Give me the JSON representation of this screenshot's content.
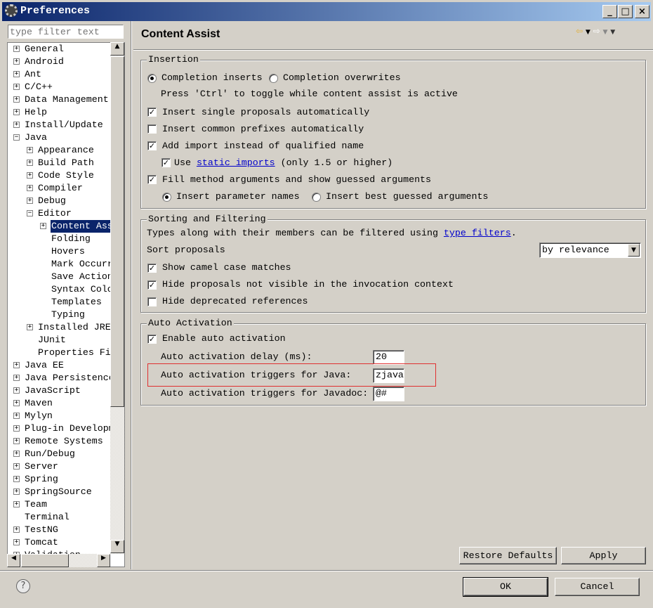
{
  "window": {
    "title": "Preferences",
    "minimize": "_",
    "maximize": "□",
    "close": "×"
  },
  "filter": {
    "placeholder": "type filter text"
  },
  "tree": [
    {
      "label": "General",
      "level": 0,
      "exp": "+"
    },
    {
      "label": "Android",
      "level": 0,
      "exp": "+"
    },
    {
      "label": "Ant",
      "level": 0,
      "exp": "+"
    },
    {
      "label": "C/C++",
      "level": 0,
      "exp": "+"
    },
    {
      "label": "Data Management",
      "level": 0,
      "exp": "+"
    },
    {
      "label": "Help",
      "level": 0,
      "exp": "+"
    },
    {
      "label": "Install/Update",
      "level": 0,
      "exp": "+"
    },
    {
      "label": "Java",
      "level": 0,
      "exp": "-"
    },
    {
      "label": "Appearance",
      "level": 1,
      "exp": "+"
    },
    {
      "label": "Build Path",
      "level": 1,
      "exp": "+"
    },
    {
      "label": "Code Style",
      "level": 1,
      "exp": "+"
    },
    {
      "label": "Compiler",
      "level": 1,
      "exp": "+"
    },
    {
      "label": "Debug",
      "level": 1,
      "exp": "+"
    },
    {
      "label": "Editor",
      "level": 1,
      "exp": "-"
    },
    {
      "label": "Content Assist",
      "level": 2,
      "exp": "+",
      "selected": true
    },
    {
      "label": "Folding",
      "level": 2,
      "exp": ""
    },
    {
      "label": "Hovers",
      "level": 2,
      "exp": ""
    },
    {
      "label": "Mark Occurrences",
      "level": 2,
      "exp": ""
    },
    {
      "label": "Save Actions",
      "level": 2,
      "exp": ""
    },
    {
      "label": "Syntax Coloring",
      "level": 2,
      "exp": ""
    },
    {
      "label": "Templates",
      "level": 2,
      "exp": ""
    },
    {
      "label": "Typing",
      "level": 2,
      "exp": ""
    },
    {
      "label": "Installed JREs",
      "level": 1,
      "exp": "+"
    },
    {
      "label": "JUnit",
      "level": 1,
      "exp": ""
    },
    {
      "label": "Properties Files Editor",
      "level": 1,
      "exp": ""
    },
    {
      "label": "Java EE",
      "level": 0,
      "exp": "+"
    },
    {
      "label": "Java Persistence",
      "level": 0,
      "exp": "+"
    },
    {
      "label": "JavaScript",
      "level": 0,
      "exp": "+"
    },
    {
      "label": "Maven",
      "level": 0,
      "exp": "+"
    },
    {
      "label": "Mylyn",
      "level": 0,
      "exp": "+"
    },
    {
      "label": "Plug-in Development",
      "level": 0,
      "exp": "+"
    },
    {
      "label": "Remote Systems",
      "level": 0,
      "exp": "+"
    },
    {
      "label": "Run/Debug",
      "level": 0,
      "exp": "+"
    },
    {
      "label": "Server",
      "level": 0,
      "exp": "+"
    },
    {
      "label": "Spring",
      "level": 0,
      "exp": "+"
    },
    {
      "label": "SpringSource",
      "level": 0,
      "exp": "+"
    },
    {
      "label": "Team",
      "level": 0,
      "exp": "+"
    },
    {
      "label": "Terminal",
      "level": 0,
      "exp": ""
    },
    {
      "label": "TestNG",
      "level": 0,
      "exp": "+"
    },
    {
      "label": "Tomcat",
      "level": 0,
      "exp": "+"
    },
    {
      "label": "Validation",
      "level": 0,
      "exp": "+"
    }
  ],
  "page": {
    "title": "Content Assist",
    "nav_icons": [
      "back-arrow-icon",
      "dropdown-icon",
      "forward-arrow-icon",
      "dropdown-icon",
      "menu-dropdown-icon"
    ]
  },
  "insertion": {
    "legend": "Insertion",
    "completion_inserts": "Completion inserts",
    "completion_overwrites": "Completion overwrites",
    "hint": "Press 'Ctrl' to toggle while content assist is active",
    "single_proposals": "Insert single proposals automatically",
    "common_prefixes": "Insert common prefixes automatically",
    "add_import": "Add import instead of qualified name",
    "use": "Use",
    "static_imports": "static imports",
    "only": "(only 1.5 or higher)",
    "fill_args": "Fill method arguments and show guessed arguments",
    "param_names": "Insert parameter names",
    "best_guessed": "Insert best guessed arguments",
    "checked": {
      "single": true,
      "prefixes": false,
      "import": true,
      "static": true,
      "fill": true
    }
  },
  "sorting": {
    "legend": "Sorting and Filtering",
    "desc": "Types along with their members can be filtered using",
    "type_filters": "type filters",
    "period": ".",
    "sort_label": "Sort proposals",
    "sort_value": "by relevance",
    "camel": "Show camel case matches",
    "hide_not_visible": "Hide proposals not visible in the invocation context",
    "hide_deprecated": "Hide deprecated references",
    "checked": {
      "camel": true,
      "not_visible": true,
      "deprecated": false
    }
  },
  "auto": {
    "legend": "Auto Activation",
    "enable": "Enable auto activation",
    "delay_label": "Auto activation delay (ms):",
    "delay_value": "20",
    "java_label": "Auto activation triggers for Java:",
    "java_value": "zjava",
    "javadoc_label": "Auto activation triggers for Javadoc:",
    "javadoc_value": "@#",
    "highlight_color": "#e03030"
  },
  "buttons": {
    "restore": "Restore Defaults",
    "apply": "Apply",
    "ok": "OK",
    "cancel": "Cancel",
    "help": "?"
  }
}
